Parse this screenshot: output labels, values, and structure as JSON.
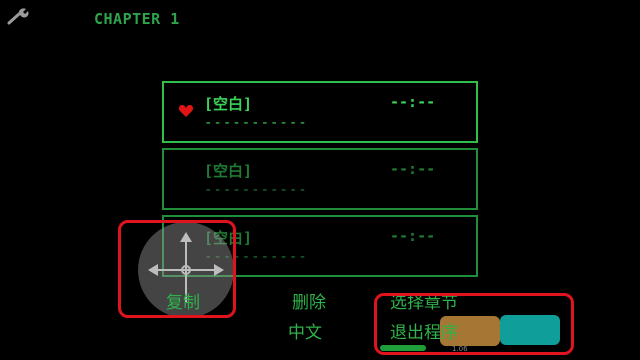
{
  "header": {
    "chapter_title": "CHAPTER 1",
    "settings_icon": "wrench-icon"
  },
  "save_slots": [
    {
      "name": "[空白]",
      "dashes": "-----------",
      "time": "--:--",
      "selected": true
    },
    {
      "name": "[空白]",
      "dashes": "-----------",
      "time": "--:--",
      "selected": false
    },
    {
      "name": "[空白]",
      "dashes": "-----------",
      "time": "--:--",
      "selected": false
    }
  ],
  "cursor_icon": "heart-icon",
  "menu": {
    "copy": "复制",
    "delete": "删除",
    "select_chapter": "选择章节",
    "language": "中文",
    "quit": "退出程序"
  },
  "overlay": {
    "dpad_icon": "dpad-icon",
    "tiny_label": "1.06"
  },
  "colors": {
    "text_green": "#2fb34a",
    "highlight_red": "#e0141e",
    "button_orange": "#b8843a",
    "button_teal": "#0f9e9a",
    "heart": "#e01414"
  }
}
